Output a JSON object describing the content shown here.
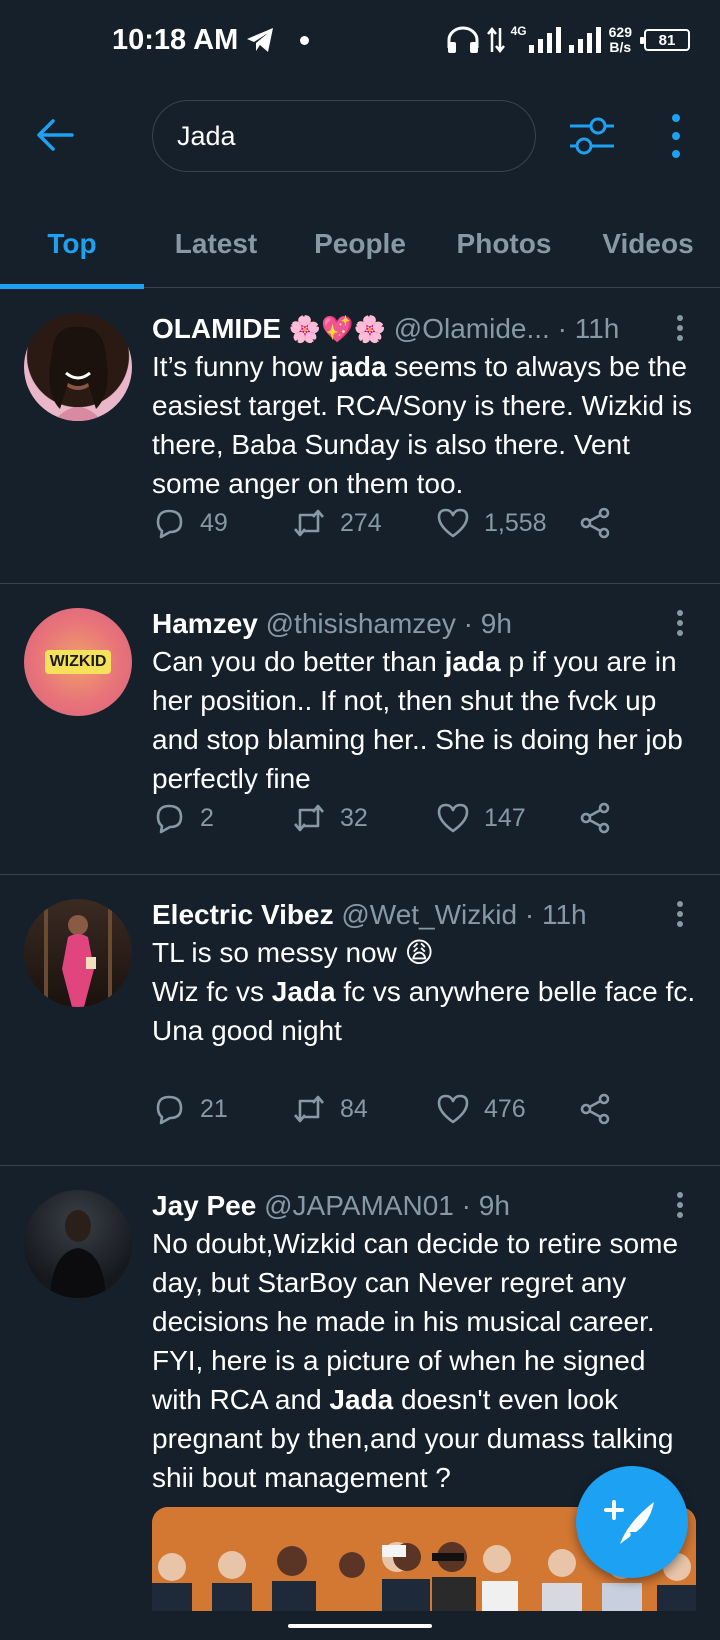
{
  "status_bar": {
    "time": "10:18 AM",
    "network": "4G",
    "speed_value": "629",
    "speed_unit": "B/s",
    "battery": "81"
  },
  "search": {
    "query": "Jada"
  },
  "tabs": [
    {
      "label": "Top",
      "active": true
    },
    {
      "label": "Latest",
      "active": false
    },
    {
      "label": "People",
      "active": false
    },
    {
      "label": "Photos",
      "active": false
    },
    {
      "label": "Videos",
      "active": false
    }
  ],
  "tweets": [
    {
      "name": "OLAMIDE",
      "emoji": "🌸💖🌸",
      "handle": "@Olamide...",
      "time": "· 11h",
      "text_parts": [
        "It’s funny how ",
        "jada",
        " seems to always be the easiest target. RCA/Sony is there. Wizkid is there, Baba Sunday is also there. Vent some anger on them too."
      ],
      "replies": "49",
      "retweets": "274",
      "likes": "1,558"
    },
    {
      "name": "Hamzey",
      "handle": "@thisishamzey",
      "time": "· 9h",
      "avatar_text": "WIZKID",
      "text_parts": [
        "Can you do better than ",
        "jada",
        " p if you are in her position.. If not, then shut the fvck up and stop blaming her.. She is doing her job perfectly fine"
      ],
      "replies": "2",
      "retweets": "32",
      "likes": "147"
    },
    {
      "name": "Electric Vibez",
      "handle": "@Wet_Wizkid",
      "time": "· 11h",
      "line1": "TL is so messy now 😩",
      "text_parts": [
        "Wiz fc vs ",
        "Jada",
        " fc vs anywhere belle face fc."
      ],
      "line3": "Una good night",
      "replies": "21",
      "retweets": "84",
      "likes": "476"
    },
    {
      "name": "Jay Pee",
      "handle": "@JAPAMAN01",
      "time": "· 9h",
      "text_parts": [
        "No doubt,Wizkid can decide to retire some day, but StarBoy can Never regret any decisions he made in his musical career. FYI, here is a picture of when he signed with RCA and ",
        "Jada",
        " doesn't even look pregnant by then,and your dumass talking shii bout management ?"
      ]
    }
  ],
  "colors": {
    "background": "#15202b",
    "accent": "#1da1f2",
    "secondary_text": "#8899a6",
    "divider": "#38444d"
  }
}
